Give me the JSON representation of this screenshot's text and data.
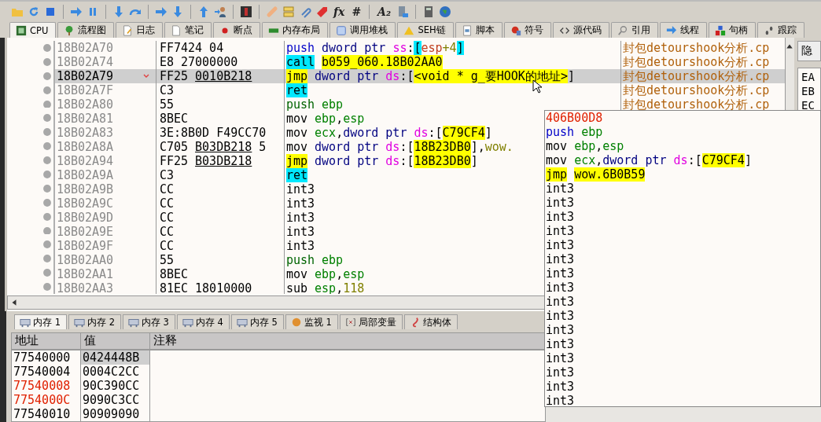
{
  "toolbar": {
    "glyph_buttons": [
      "fx",
      "#",
      "A₂"
    ]
  },
  "tabs": [
    {
      "label": "CPU",
      "selected": true
    },
    {
      "label": "流程图",
      "selected": false
    },
    {
      "label": "日志",
      "selected": false
    },
    {
      "label": "笔记",
      "selected": false
    },
    {
      "label": "断点",
      "selected": false
    },
    {
      "label": "内存布局",
      "selected": false
    },
    {
      "label": "调用堆栈",
      "selected": false
    },
    {
      "label": "SEH链",
      "selected": false
    },
    {
      "label": "脚本",
      "selected": false
    },
    {
      "label": "符号",
      "selected": false
    },
    {
      "label": "源代码",
      "selected": false
    },
    {
      "label": "引用",
      "selected": false
    },
    {
      "label": "线程",
      "selected": false
    },
    {
      "label": "句柄",
      "selected": false
    },
    {
      "label": "跟踪",
      "selected": false
    }
  ],
  "disassembly": [
    {
      "address": "18B02A70",
      "selected": false,
      "jump_arrow": false,
      "bytes": [
        {
          "text": "FF7424 04",
          "underline": false
        }
      ],
      "instruction": [
        [
          {
            "text": "push",
            "kind": "push"
          }
        ],
        [
          {
            "text": "dword ptr",
            "kind": "keyword"
          }
        ],
        [
          {
            "text": "ss",
            "kind": "segment"
          },
          {
            "text": ":",
            "kind": "plain"
          },
          {
            "text": "[",
            "kind": "bracket"
          },
          {
            "text": "esp",
            "kind": "stackreg"
          },
          {
            "text": "+4",
            "kind": "number"
          },
          {
            "text": "]",
            "kind": "bracket"
          }
        ]
      ],
      "comment": "封包detourshook分析.cp"
    },
    {
      "address": "18B02A74",
      "selected": false,
      "jump_arrow": false,
      "bytes": [
        {
          "text": "E8 27000000",
          "underline": false
        }
      ],
      "instruction": [
        [
          {
            "text": "call",
            "kind": "call"
          }
        ],
        [
          {
            "text": "b059_060.18B02AA0",
            "kind": "address"
          }
        ]
      ],
      "comment": "封包detourshook分析.cp"
    },
    {
      "address": "18B02A79",
      "selected": true,
      "jump_arrow": true,
      "bytes": [
        {
          "text": "FF25",
          "underline": false
        },
        {
          "text": "0010B218",
          "underline": true
        }
      ],
      "instruction": [
        [
          {
            "text": "jmp",
            "kind": "jmp"
          }
        ],
        [
          {
            "text": "dword ptr",
            "kind": "keyword"
          }
        ],
        [
          {
            "text": "ds",
            "kind": "segment"
          },
          {
            "text": ":[",
            "kind": "plain"
          },
          {
            "text": "<void * g_要HOOK的地址>",
            "kind": "address"
          },
          {
            "text": "]",
            "kind": "plain"
          }
        ]
      ],
      "comment": "封包detourshook分析.cp"
    },
    {
      "address": "18B02A7F",
      "selected": false,
      "jump_arrow": false,
      "bytes": [
        {
          "text": "C3",
          "underline": false
        }
      ],
      "instruction": [
        [
          {
            "text": "ret",
            "kind": "ret"
          }
        ]
      ],
      "comment": "封包detourshook分析.cp"
    },
    {
      "address": "18B02A80",
      "selected": false,
      "jump_arrow": false,
      "bytes": [
        {
          "text": "55",
          "underline": false
        }
      ],
      "instruction": [
        [
          {
            "text": "push",
            "kind": "plainpush"
          }
        ],
        [
          {
            "text": "ebp",
            "kind": "register"
          }
        ]
      ],
      "comment": "封包detourshook分析.cp"
    },
    {
      "address": "18B02A81",
      "selected": false,
      "jump_arrow": false,
      "bytes": [
        {
          "text": "8BEC",
          "underline": false
        }
      ],
      "instruction": [
        [
          {
            "text": "mov",
            "kind": "plain"
          }
        ],
        [
          {
            "text": "ebp",
            "kind": "register"
          },
          {
            "text": ",",
            "kind": "plain"
          },
          {
            "text": "esp",
            "kind": "register"
          }
        ]
      ]
    },
    {
      "address": "18B02A83",
      "selected": false,
      "jump_arrow": false,
      "bytes": [
        {
          "text": "3E:8B0D F49CC70",
          "underline": false
        }
      ],
      "instruction": [
        [
          {
            "text": "mov",
            "kind": "plain"
          }
        ],
        [
          {
            "text": "ecx",
            "kind": "register"
          },
          {
            "text": ",",
            "kind": "plain"
          },
          {
            "text": "dword ptr",
            "kind": "keyword"
          }
        ],
        [
          {
            "text": "ds",
            "kind": "segment"
          },
          {
            "text": ":[",
            "kind": "plain"
          },
          {
            "text": "C79CF4",
            "kind": "address"
          },
          {
            "text": "]",
            "kind": "plain"
          }
        ]
      ]
    },
    {
      "address": "18B02A8A",
      "selected": false,
      "jump_arrow": false,
      "bytes": [
        {
          "text": "C705",
          "underline": false
        },
        {
          "text": "B03DB218",
          "underline": true
        },
        {
          "text": "5",
          "underline": false
        }
      ],
      "instruction": [
        [
          {
            "text": "mov",
            "kind": "plain"
          }
        ],
        [
          {
            "text": "dword ptr",
            "kind": "keyword"
          }
        ],
        [
          {
            "text": "ds",
            "kind": "segment"
          },
          {
            "text": ":[",
            "kind": "plain"
          },
          {
            "text": "18B23DB0",
            "kind": "address"
          },
          {
            "text": "],",
            "kind": "plain"
          },
          {
            "text": "wow.",
            "kind": "label"
          }
        ]
      ]
    },
    {
      "address": "18B02A94",
      "selected": false,
      "jump_arrow": false,
      "bytes": [
        {
          "text": "FF25",
          "underline": false
        },
        {
          "text": "B03DB218",
          "underline": true
        }
      ],
      "instruction": [
        [
          {
            "text": "jmp",
            "kind": "jmp"
          }
        ],
        [
          {
            "text": "dword ptr",
            "kind": "keyword"
          }
        ],
        [
          {
            "text": "ds",
            "kind": "segment"
          },
          {
            "text": ":[",
            "kind": "plain"
          },
          {
            "text": "18B23DB0",
            "kind": "address"
          },
          {
            "text": "]",
            "kind": "plain"
          }
        ]
      ]
    },
    {
      "address": "18B02A9A",
      "selected": false,
      "jump_arrow": false,
      "bytes": [
        {
          "text": "C3",
          "underline": false
        }
      ],
      "instruction": [
        [
          {
            "text": "ret",
            "kind": "ret"
          }
        ]
      ]
    },
    {
      "address": "18B02A9B",
      "selected": false,
      "jump_arrow": false,
      "bytes": [
        {
          "text": "CC",
          "underline": false
        }
      ],
      "instruction": [
        [
          {
            "text": "int3",
            "kind": "plain"
          }
        ]
      ]
    },
    {
      "address": "18B02A9C",
      "selected": false,
      "jump_arrow": false,
      "bytes": [
        {
          "text": "CC",
          "underline": false
        }
      ],
      "instruction": [
        [
          {
            "text": "int3",
            "kind": "plain"
          }
        ]
      ]
    },
    {
      "address": "18B02A9D",
      "selected": false,
      "jump_arrow": false,
      "bytes": [
        {
          "text": "CC",
          "underline": false
        }
      ],
      "instruction": [
        [
          {
            "text": "int3",
            "kind": "plain"
          }
        ]
      ]
    },
    {
      "address": "18B02A9E",
      "selected": false,
      "jump_arrow": false,
      "bytes": [
        {
          "text": "CC",
          "underline": false
        }
      ],
      "instruction": [
        [
          {
            "text": "int3",
            "kind": "plain"
          }
        ]
      ]
    },
    {
      "address": "18B02A9F",
      "selected": false,
      "jump_arrow": false,
      "bytes": [
        {
          "text": "CC",
          "underline": false
        }
      ],
      "instruction": [
        [
          {
            "text": "int3",
            "kind": "plain"
          }
        ]
      ]
    },
    {
      "address": "18B02AA0",
      "selected": false,
      "jump_arrow": false,
      "bytes": [
        {
          "text": "55",
          "underline": false
        }
      ],
      "instruction": [
        [
          {
            "text": "push",
            "kind": "plainpush"
          }
        ],
        [
          {
            "text": "ebp",
            "kind": "register"
          }
        ]
      ]
    },
    {
      "address": "18B02AA1",
      "selected": false,
      "jump_arrow": false,
      "bytes": [
        {
          "text": "8BEC",
          "underline": false
        }
      ],
      "instruction": [
        [
          {
            "text": "mov",
            "kind": "plain"
          }
        ],
        [
          {
            "text": "ebp",
            "kind": "register"
          },
          {
            "text": ",",
            "kind": "plain"
          },
          {
            "text": "esp",
            "kind": "register"
          }
        ]
      ]
    },
    {
      "address": "18B02AA3",
      "selected": false,
      "jump_arrow": false,
      "bytes": [
        {
          "text": "81EC 18010000",
          "underline": false
        }
      ],
      "instruction": [
        [
          {
            "text": "sub",
            "kind": "plain"
          }
        ],
        [
          {
            "text": "esp",
            "kind": "register"
          },
          {
            "text": ",",
            "kind": "plain"
          },
          {
            "text": "118",
            "kind": "number"
          }
        ]
      ]
    }
  ],
  "registers": {
    "hide_button": "隐",
    "names": [
      "EA",
      "EB",
      "EC"
    ]
  },
  "popup": {
    "address": "406B00D8",
    "lines": [
      [
        [
          {
            "text": "push",
            "kind": "push"
          }
        ],
        [
          {
            "text": "ebp",
            "kind": "register"
          }
        ]
      ],
      [
        [
          {
            "text": "mov",
            "kind": "plain"
          }
        ],
        [
          {
            "text": "ebp",
            "kind": "register"
          },
          {
            "text": ",",
            "kind": "plain"
          },
          {
            "text": "esp",
            "kind": "register"
          }
        ]
      ],
      [
        [
          {
            "text": "mov",
            "kind": "plain"
          }
        ],
        [
          {
            "text": "ecx",
            "kind": "register"
          },
          {
            "text": ",",
            "kind": "plain"
          },
          {
            "text": "dword ptr",
            "kind": "keyword"
          }
        ],
        [
          {
            "text": "ds",
            "kind": "segment"
          },
          {
            "text": ":[",
            "kind": "plain"
          },
          {
            "text": "C79CF4",
            "kind": "address"
          },
          {
            "text": "]",
            "kind": "plain"
          }
        ]
      ],
      [
        [
          {
            "text": "jmp",
            "kind": "jmp"
          }
        ],
        [
          {
            "text": "wow.6B0B59",
            "kind": "address"
          }
        ]
      ],
      [
        [
          {
            "text": "int3",
            "kind": "plain"
          }
        ]
      ],
      [
        [
          {
            "text": "int3",
            "kind": "plain"
          }
        ]
      ],
      [
        [
          {
            "text": "int3",
            "kind": "plain"
          }
        ]
      ],
      [
        [
          {
            "text": "int3",
            "kind": "plain"
          }
        ]
      ],
      [
        [
          {
            "text": "int3",
            "kind": "plain"
          }
        ]
      ],
      [
        [
          {
            "text": "int3",
            "kind": "plain"
          }
        ]
      ],
      [
        [
          {
            "text": "int3",
            "kind": "plain"
          }
        ]
      ],
      [
        [
          {
            "text": "int3",
            "kind": "plain"
          }
        ]
      ],
      [
        [
          {
            "text": "int3",
            "kind": "plain"
          }
        ]
      ],
      [
        [
          {
            "text": "int3",
            "kind": "plain"
          }
        ]
      ],
      [
        [
          {
            "text": "int3",
            "kind": "plain"
          }
        ]
      ],
      [
        [
          {
            "text": "int3",
            "kind": "plain"
          }
        ]
      ],
      [
        [
          {
            "text": "int3",
            "kind": "plain"
          }
        ]
      ],
      [
        [
          {
            "text": "int3",
            "kind": "plain"
          }
        ]
      ],
      [
        [
          {
            "text": "int3",
            "kind": "plain"
          }
        ]
      ],
      [
        [
          {
            "text": "int3",
            "kind": "plain"
          }
        ]
      ]
    ]
  },
  "bottom_tabs": [
    {
      "label": "内存 1",
      "selected": true
    },
    {
      "label": "内存 2",
      "selected": false
    },
    {
      "label": "内存 3",
      "selected": false
    },
    {
      "label": "内存 4",
      "selected": false
    },
    {
      "label": "内存 5",
      "selected": false
    },
    {
      "label": "监视 1",
      "selected": false
    },
    {
      "label": "局部变量",
      "selected": false
    },
    {
      "label": "结构体",
      "selected": false
    }
  ],
  "memory": {
    "columns": [
      "地址",
      "值",
      "注释"
    ],
    "rows": [
      {
        "address": "77540000",
        "value": "0424448B",
        "modified": false,
        "selected": true
      },
      {
        "address": "77540004",
        "value": "0004C2CC",
        "modified": false,
        "selected": false
      },
      {
        "address": "77540008",
        "value": "90C390CC",
        "modified": true,
        "selected": false
      },
      {
        "address": "7754000C",
        "value": "9090C3CC",
        "modified": true,
        "selected": false
      },
      {
        "address": "77540010",
        "value": "90909090",
        "modified": false,
        "selected": false
      }
    ]
  }
}
